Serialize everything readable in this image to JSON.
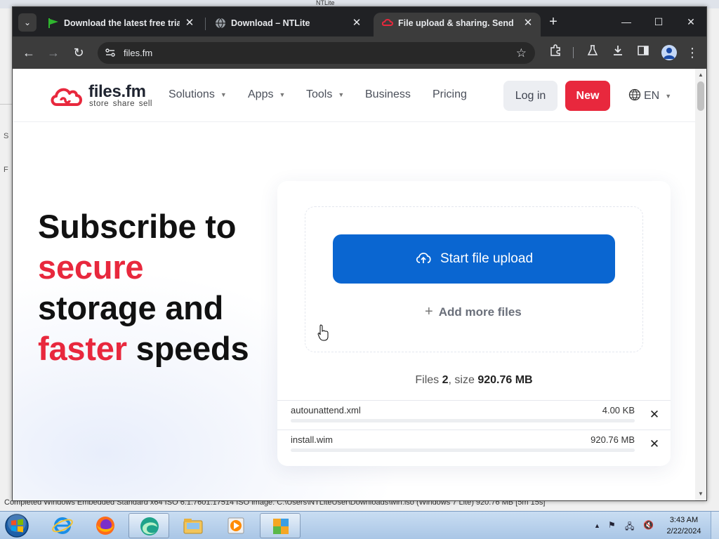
{
  "background_window": {
    "title": "NTLite",
    "side_letter_1": "S",
    "side_letter_2": "F",
    "status_text": "Completed   Windows Embedded Standard x64 ISO   6.1.7601.17514   ISO image: C:\\Users\\NTLiteUser\\Downloads\\win.iso (Windows 7 Lite) 920.76 MB [5m 15s]"
  },
  "browser": {
    "tabs": [
      {
        "label": "Download the latest free trial v",
        "close": "✕",
        "favicon": "green-flag-icon"
      },
      {
        "label": "Download – NTLite",
        "close": "✕",
        "favicon": "globe-icon"
      },
      {
        "label": "File upload & sharing. Send lar",
        "close": "✕",
        "favicon": "files-fm-cloud-icon",
        "active": true
      }
    ],
    "new_tab": "+",
    "window_controls": {
      "minimize": "—",
      "maximize": "☐",
      "close": "✕"
    },
    "address": "files.fm",
    "colors": {
      "frame": "#202124",
      "toolbar": "#3c3c3c"
    }
  },
  "site": {
    "logo_name": "files.fm",
    "logo_tagline": "store share sell",
    "nav": [
      {
        "label": "Solutions",
        "dropdown": true
      },
      {
        "label": "Apps",
        "dropdown": true
      },
      {
        "label": "Tools",
        "dropdown": true
      },
      {
        "label": "Business",
        "dropdown": false
      },
      {
        "label": "Pricing",
        "dropdown": false
      }
    ],
    "login_label": "Log in",
    "new_label": "New",
    "language": "EN",
    "colors": {
      "brand_red": "#e8283d",
      "upload_blue": "#0a66d1"
    }
  },
  "hero": {
    "line1": "Subscribe to",
    "line2_accent": "secure",
    "line3": "storage and",
    "line4_accent": "faster",
    "line4_rest": " speeds"
  },
  "upload": {
    "start_label": "Start file upload",
    "add_more_label": "Add more files",
    "summary_prefix": "Files ",
    "file_count": "2",
    "summary_mid": ", size ",
    "total_size": "920.76 MB",
    "files": [
      {
        "name": "autounattend.xml",
        "size": "4.00 KB",
        "progress": 0
      },
      {
        "name": "install.wim",
        "size": "920.76 MB",
        "progress": 0
      }
    ]
  },
  "taskbar": {
    "apps": [
      "internet-explorer-icon",
      "firefox-icon",
      "edge-icon",
      "file-explorer-icon",
      "media-player-icon",
      "ntlite-icon"
    ],
    "clock_time": "3:43 AM",
    "clock_date": "2/22/2024"
  }
}
